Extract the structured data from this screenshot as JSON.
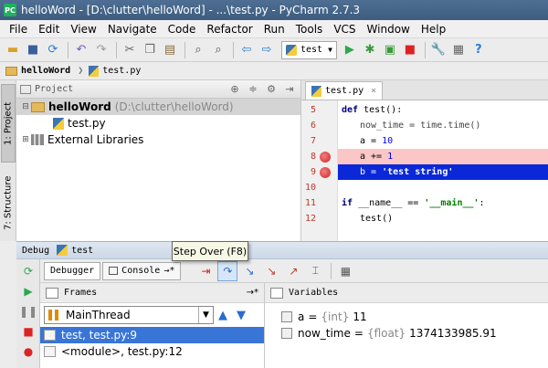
{
  "window": {
    "title": "helloWord - [D:\\clutter\\helloWord] - ...\\test.py - PyCharm 2.7.3"
  },
  "menu": [
    "File",
    "Edit",
    "View",
    "Navigate",
    "Code",
    "Refactor",
    "Run",
    "Tools",
    "VCS",
    "Window",
    "Help"
  ],
  "toolbar": {
    "run_config": "test"
  },
  "breadcrumb": [
    "helloWord",
    "test.py"
  ],
  "left_strip": {
    "project_tab": "1: Project",
    "structure_tab": "7: Structure"
  },
  "project": {
    "header": "Project",
    "tree": [
      {
        "label": "helloWord",
        "path": "(D:\\clutter\\helloWord)"
      },
      {
        "label": "test.py"
      },
      {
        "label": "External Libraries"
      }
    ]
  },
  "editor": {
    "tab": "test.py",
    "lines": [
      {
        "n": "5",
        "code": "def test():"
      },
      {
        "n": "6",
        "code": "now_time = time.time()"
      },
      {
        "n": "7",
        "code": "a = 10"
      },
      {
        "n": "8",
        "code": "a += 1"
      },
      {
        "n": "9",
        "code": "b = 'test string'"
      },
      {
        "n": "10",
        "code": ""
      },
      {
        "n": "11",
        "code": "if __name__ == '__main__':"
      },
      {
        "n": "12",
        "code": "test()"
      }
    ]
  },
  "debug": {
    "label": "Debug",
    "config": "test",
    "tabs": {
      "debugger": "Debugger",
      "console": "Console"
    },
    "tooltip": "Step Over (F8)",
    "frames": {
      "header": "Frames",
      "thread": "MainThread",
      "items": [
        "test, test.py:9",
        "<module>, test.py:12"
      ]
    },
    "variables": {
      "header": "Variables",
      "items": [
        {
          "name": "a",
          "type": "{int}",
          "value": "11"
        },
        {
          "name": "now_time",
          "type": "{float}",
          "value": "1374133985.91"
        }
      ]
    }
  }
}
